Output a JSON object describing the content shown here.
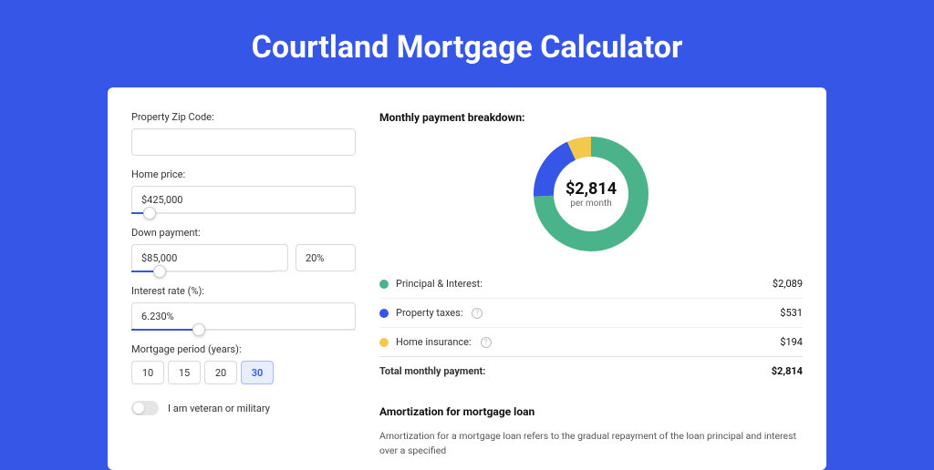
{
  "hero": {
    "title": "Courtland Mortgage Calculator"
  },
  "form": {
    "zip": {
      "label": "Property Zip Code:",
      "value": ""
    },
    "price": {
      "label": "Home price:",
      "value": "$425,000",
      "slider_pct": 8
    },
    "down": {
      "label": "Down payment:",
      "amount": "$85,000",
      "pct": "20%",
      "slider_pct": 20
    },
    "rate": {
      "label": "Interest rate (%):",
      "value": "6.230%",
      "slider_pct": 30
    },
    "period": {
      "label": "Mortgage period (years):",
      "options": [
        "10",
        "15",
        "20",
        "30"
      ],
      "selected": 3
    },
    "veteran": {
      "label": "I am veteran or military",
      "checked": false
    }
  },
  "breakdown": {
    "title": "Monthly payment breakdown:",
    "center_amount": "$2,814",
    "center_sub": "per month",
    "items": [
      {
        "label": "Principal & Interest:",
        "value": "$2,089",
        "color": "#4bb38a",
        "info": false
      },
      {
        "label": "Property taxes:",
        "value": "$531",
        "color": "#3556e6",
        "info": true
      },
      {
        "label": "Home insurance:",
        "value": "$194",
        "color": "#f2c94c",
        "info": true
      }
    ],
    "total": {
      "label": "Total monthly payment:",
      "value": "$2,814"
    }
  },
  "chart_data": {
    "type": "pie",
    "title": "Monthly payment breakdown",
    "series": [
      {
        "name": "Principal & Interest",
        "value": 2089,
        "color": "#4bb38a"
      },
      {
        "name": "Property taxes",
        "value": 531,
        "color": "#3556e6"
      },
      {
        "name": "Home insurance",
        "value": 194,
        "color": "#f2c94c"
      }
    ],
    "total": 2814,
    "donut_radius": 52,
    "donut_stroke": 22
  },
  "amort": {
    "title": "Amortization for mortgage loan",
    "text": "Amortization for a mortgage loan refers to the gradual repayment of the loan principal and interest over a specified"
  }
}
